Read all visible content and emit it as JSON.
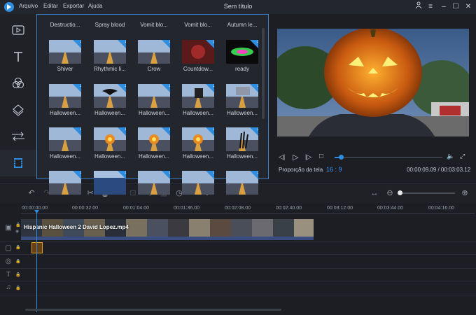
{
  "menu": [
    "Arquivo",
    "Editar",
    "Exportar",
    "Ajuda"
  ],
  "window_title": "Sem título",
  "window_buttons": [
    "user-icon",
    "settings-icon",
    "minimize-icon",
    "maximize-icon",
    "close-icon"
  ],
  "toolbar_tools": [
    "media-icon",
    "text-icon",
    "filters-icon",
    "overlays-icon",
    "transitions-icon",
    "film-icon"
  ],
  "media": {
    "categories": [
      "Destructio...",
      "Spray blood",
      "Vomit blo...",
      "Vomit blo...",
      "Autumn le..."
    ],
    "rows": [
      [
        "Shiver",
        "Rhythmic li...",
        "Crow",
        "Countdow...",
        "ready"
      ],
      [
        "Halloween...",
        "Halloween...",
        "Halloween...",
        "Halloween...",
        "Halloween..."
      ],
      [
        "Halloween...",
        "Halloween...",
        "Halloween...",
        "Halloween...",
        "Halloween..."
      ],
      [
        "",
        "",
        "",
        "",
        ""
      ]
    ]
  },
  "preview": {
    "ratio_label": "Proporção da tela",
    "ratio_value": "16 : 9",
    "time": "00:00:09.09 / 00:03:03.12",
    "progress": 0.05
  },
  "ruler_ticks": [
    "00:00:00.00",
    "00:00:32.00",
    "00:01:04.00",
    "00:01:36.00",
    "00:02:08.00",
    "00:02:40.00",
    "00:03:12.00",
    "00:03:44.00",
    "00:04:16.00"
  ],
  "timeline": {
    "clip_name": "Hispanic Halloween 2  David Lopez.mp4",
    "zoom_level": 0.0
  },
  "colors": {
    "accent": "#2f8de0",
    "panel": "#23262d",
    "background": "#1c1e24"
  }
}
